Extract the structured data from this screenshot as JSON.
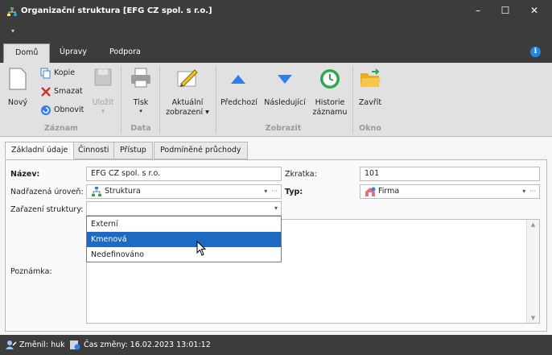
{
  "window": {
    "title": "Organizační struktura [EFG CZ spol. s r.o.]",
    "minimize_glyph": "–",
    "maximize_glyph": "☐",
    "close_glyph": "✕"
  },
  "quick_access": {
    "dropdown_glyph": "▾"
  },
  "ribbon_tabs": [
    "Domů",
    "Úpravy",
    "Podpora"
  ],
  "info_glyph": "i",
  "ribbon": {
    "novy": "Nový",
    "kopie": "Kopie",
    "smazat": "Smazat",
    "obnovit": "Obnovit",
    "ulozit": "Uložit",
    "tisk": "Tisk",
    "aktualni_1": "Aktuální",
    "aktualni_2": "zobrazení",
    "predchozi": "Předchozí",
    "nasledujici": "Následující",
    "historie_1": "Historie",
    "historie_2": "záznamu",
    "zavrit": "Zavřít",
    "groups": [
      "Záznam",
      "Data",
      "Zobrazit",
      "Okno"
    ]
  },
  "form_tabs": [
    "Základní údaje",
    "Činnosti",
    "Přístup",
    "Podmíněné průchody"
  ],
  "form": {
    "nazev_label": "Název:",
    "nazev_value": "EFG CZ spol. s r.o.",
    "zkratka_label": "Zkratka:",
    "zkratka_value": "101",
    "nadrazena_label": "Nadřazená úroveň:",
    "nadrazena_value": "Struktura",
    "typ_label": "Typ:",
    "typ_value": "Firma",
    "zarazeni_label": "Zařazení struktury:",
    "zarazeni_value": "",
    "poznamka_label": "Poznámka:",
    "dropdown_options": [
      "Externí",
      "Kmenová",
      "Nedefinováno"
    ],
    "selected_option": "Kmenová"
  },
  "status": {
    "zmenil": "Změnil: huk",
    "cas": "Čas změny: 16.02.2023 13:01:12"
  },
  "colors": {
    "chrome": "#3c3c3c",
    "selection": "#1c6ac4",
    "ribbon": "#e1e1e1"
  }
}
